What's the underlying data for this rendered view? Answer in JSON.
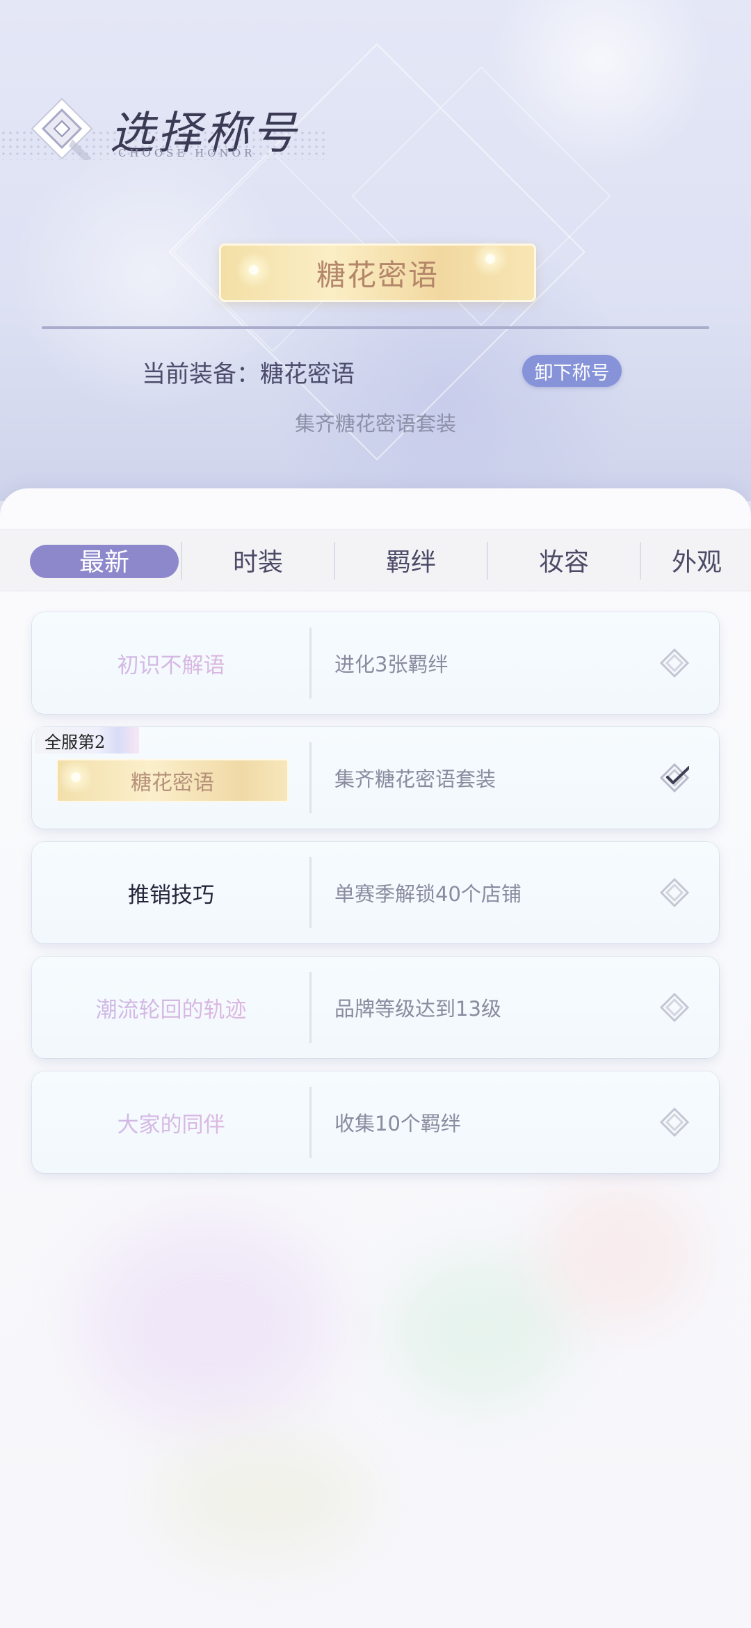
{
  "header": {
    "title": "选择称号",
    "subtitle": "CHOOSE HONOR",
    "equipped_plate": "糖花密语",
    "current_label": "当前装备：糖花密语",
    "unequip_button": "卸下称号",
    "current_desc": "集齐糖花密语套装"
  },
  "tabs": [
    {
      "label": "最新",
      "active": true
    },
    {
      "label": "时装",
      "active": false
    },
    {
      "label": "羁绊",
      "active": false
    },
    {
      "label": "妆容",
      "active": false
    },
    {
      "label": "外观",
      "active": false
    }
  ],
  "honors": [
    {
      "name": "初识不解语",
      "condition": "进化3张羁绊",
      "state": "locked",
      "icon": "diamond-icon"
    },
    {
      "name": "糖花密语",
      "condition": "集齐糖花密语套装",
      "state": "equipped",
      "rank": "全服第2",
      "icon": "check-icon"
    },
    {
      "name": "推销技巧",
      "condition": "单赛季解锁40个店铺",
      "state": "unlocked",
      "icon": "diamond-icon"
    },
    {
      "name": "潮流轮回的轨迹",
      "condition": "品牌等级达到13级",
      "state": "locked",
      "icon": "diamond-icon"
    },
    {
      "name": "大家的同伴",
      "condition": "收集10个羁绊",
      "state": "locked",
      "icon": "diamond-icon"
    }
  ],
  "colors": {
    "accent": "#8d88cc",
    "button": "#8793d8",
    "gold_plate": "#f3dfa6",
    "locked_text": "#c8b9e9"
  }
}
